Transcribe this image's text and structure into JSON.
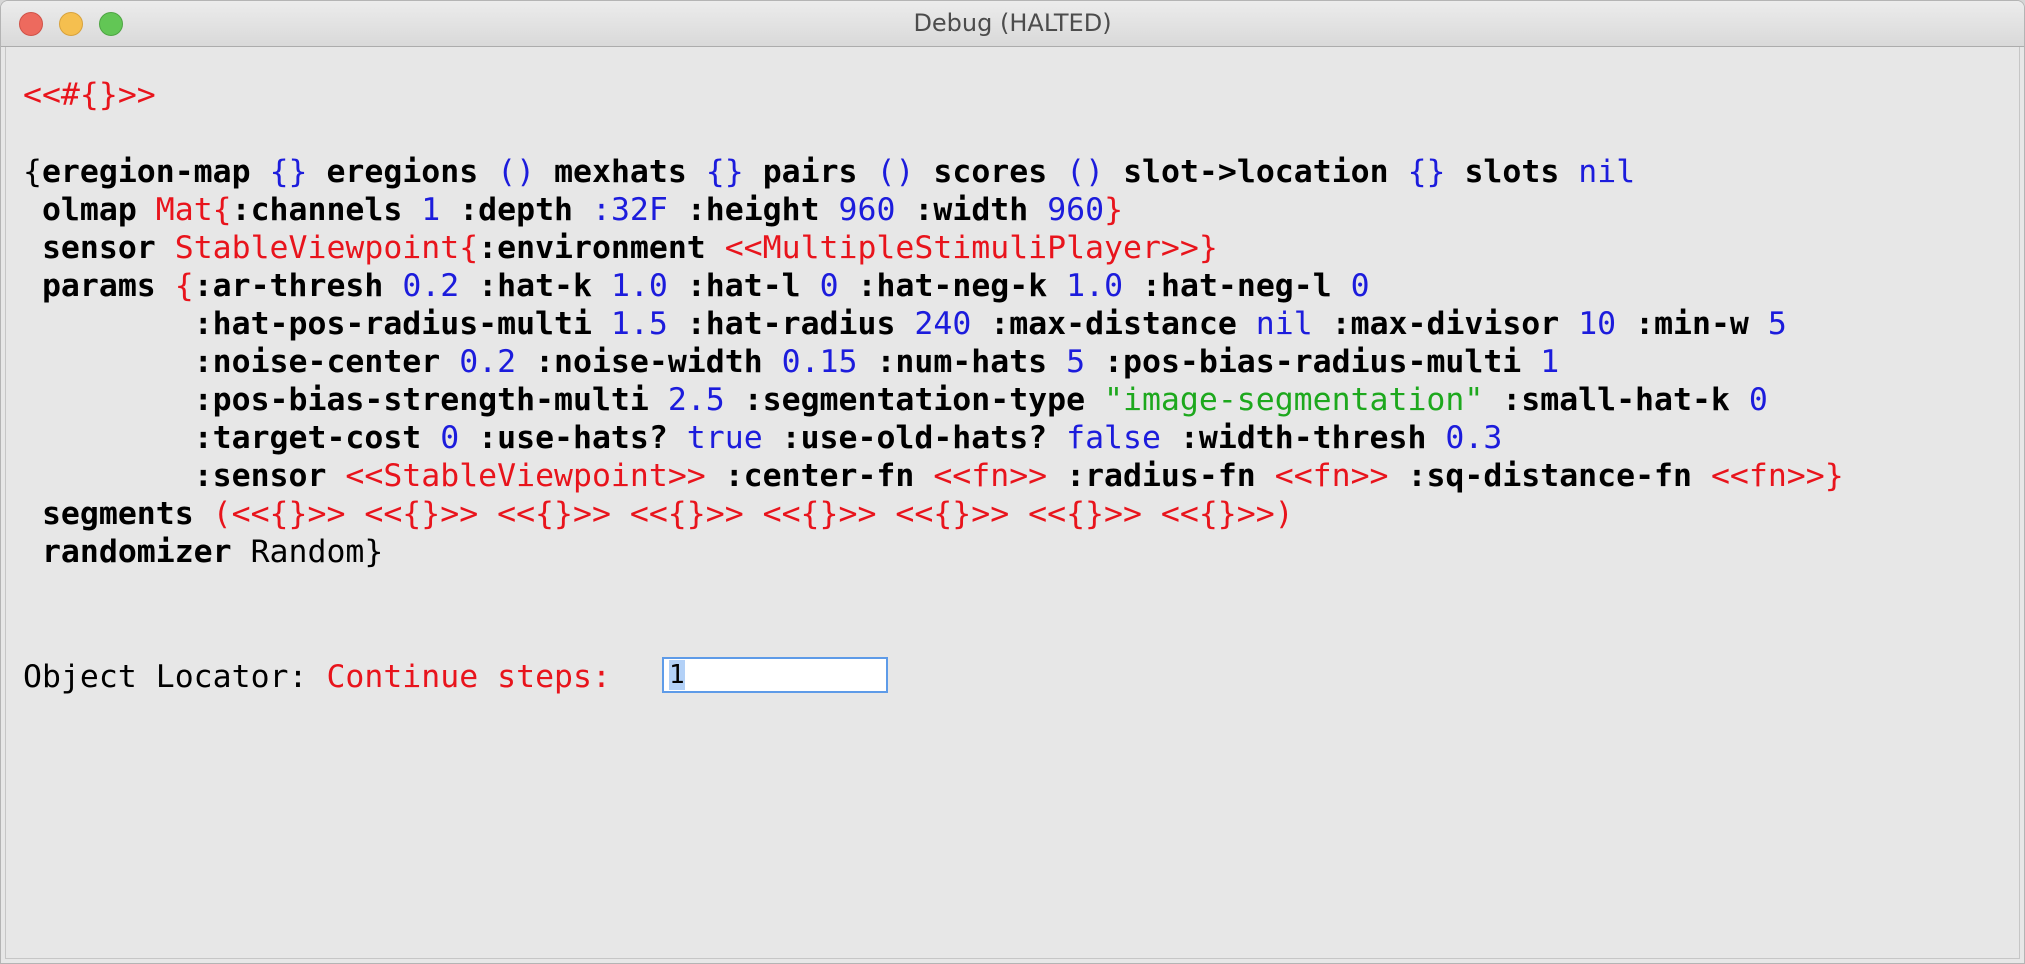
{
  "window": {
    "title": "Debug (HALTED)"
  },
  "repl": {
    "header": "<<#{}>>",
    "lines": [
      [
        {
          "t": "{",
          "c": "plain"
        },
        {
          "t": "eregion-map",
          "c": "k"
        },
        {
          "t": " ",
          "c": "plain"
        },
        {
          "t": "{}",
          "c": "b"
        },
        {
          "t": " ",
          "c": "plain"
        },
        {
          "t": "eregions",
          "c": "k"
        },
        {
          "t": " ",
          "c": "plain"
        },
        {
          "t": "()",
          "c": "b"
        },
        {
          "t": " ",
          "c": "plain"
        },
        {
          "t": "mexhats",
          "c": "k"
        },
        {
          "t": " ",
          "c": "plain"
        },
        {
          "t": "{}",
          "c": "b"
        },
        {
          "t": " ",
          "c": "plain"
        },
        {
          "t": "pairs",
          "c": "k"
        },
        {
          "t": " ",
          "c": "plain"
        },
        {
          "t": "()",
          "c": "b"
        },
        {
          "t": " ",
          "c": "plain"
        },
        {
          "t": "scores",
          "c": "k"
        },
        {
          "t": " ",
          "c": "plain"
        },
        {
          "t": "()",
          "c": "b"
        },
        {
          "t": " ",
          "c": "plain"
        },
        {
          "t": "slot->location",
          "c": "k"
        },
        {
          "t": " ",
          "c": "plain"
        },
        {
          "t": "{}",
          "c": "b"
        },
        {
          "t": " ",
          "c": "plain"
        },
        {
          "t": "slots",
          "c": "k"
        },
        {
          "t": " ",
          "c": "plain"
        },
        {
          "t": "nil",
          "c": "b"
        }
      ],
      [
        {
          "t": " ",
          "c": "plain"
        },
        {
          "t": "olmap",
          "c": "k"
        },
        {
          "t": " ",
          "c": "plain"
        },
        {
          "t": "Mat{",
          "c": "r"
        },
        {
          "t": ":channels",
          "c": "k"
        },
        {
          "t": " ",
          "c": "plain"
        },
        {
          "t": "1",
          "c": "b"
        },
        {
          "t": " ",
          "c": "plain"
        },
        {
          "t": ":depth",
          "c": "k"
        },
        {
          "t": " ",
          "c": "plain"
        },
        {
          "t": ":32F",
          "c": "b"
        },
        {
          "t": " ",
          "c": "plain"
        },
        {
          "t": ":height",
          "c": "k"
        },
        {
          "t": " ",
          "c": "plain"
        },
        {
          "t": "960",
          "c": "b"
        },
        {
          "t": " ",
          "c": "plain"
        },
        {
          "t": ":width",
          "c": "k"
        },
        {
          "t": " ",
          "c": "plain"
        },
        {
          "t": "960",
          "c": "b"
        },
        {
          "t": "}",
          "c": "r"
        }
      ],
      [
        {
          "t": " ",
          "c": "plain"
        },
        {
          "t": "sensor",
          "c": "k"
        },
        {
          "t": " ",
          "c": "plain"
        },
        {
          "t": "StableViewpoint{",
          "c": "r"
        },
        {
          "t": ":environment",
          "c": "k"
        },
        {
          "t": " ",
          "c": "plain"
        },
        {
          "t": "<<MultipleStimuliPlayer>>",
          "c": "r"
        },
        {
          "t": "}",
          "c": "r"
        }
      ],
      [
        {
          "t": " ",
          "c": "plain"
        },
        {
          "t": "params",
          "c": "k"
        },
        {
          "t": " ",
          "c": "plain"
        },
        {
          "t": "{",
          "c": "r"
        },
        {
          "t": ":ar-thresh",
          "c": "k"
        },
        {
          "t": " ",
          "c": "plain"
        },
        {
          "t": "0.2",
          "c": "b"
        },
        {
          "t": " ",
          "c": "plain"
        },
        {
          "t": ":hat-k",
          "c": "k"
        },
        {
          "t": " ",
          "c": "plain"
        },
        {
          "t": "1.0",
          "c": "b"
        },
        {
          "t": " ",
          "c": "plain"
        },
        {
          "t": ":hat-l",
          "c": "k"
        },
        {
          "t": " ",
          "c": "plain"
        },
        {
          "t": "0",
          "c": "b"
        },
        {
          "t": " ",
          "c": "plain"
        },
        {
          "t": ":hat-neg-k",
          "c": "k"
        },
        {
          "t": " ",
          "c": "plain"
        },
        {
          "t": "1.0",
          "c": "b"
        },
        {
          "t": " ",
          "c": "plain"
        },
        {
          "t": ":hat-neg-l",
          "c": "k"
        },
        {
          "t": " ",
          "c": "plain"
        },
        {
          "t": "0",
          "c": "b"
        }
      ],
      [
        {
          "t": "         ",
          "c": "plain"
        },
        {
          "t": ":hat-pos-radius-multi",
          "c": "k"
        },
        {
          "t": " ",
          "c": "plain"
        },
        {
          "t": "1.5",
          "c": "b"
        },
        {
          "t": " ",
          "c": "plain"
        },
        {
          "t": ":hat-radius",
          "c": "k"
        },
        {
          "t": " ",
          "c": "plain"
        },
        {
          "t": "240",
          "c": "b"
        },
        {
          "t": " ",
          "c": "plain"
        },
        {
          "t": ":max-distance",
          "c": "k"
        },
        {
          "t": " ",
          "c": "plain"
        },
        {
          "t": "nil",
          "c": "b"
        },
        {
          "t": " ",
          "c": "plain"
        },
        {
          "t": ":max-divisor",
          "c": "k"
        },
        {
          "t": " ",
          "c": "plain"
        },
        {
          "t": "10",
          "c": "b"
        },
        {
          "t": " ",
          "c": "plain"
        },
        {
          "t": ":min-w",
          "c": "k"
        },
        {
          "t": " ",
          "c": "plain"
        },
        {
          "t": "5",
          "c": "b"
        }
      ],
      [
        {
          "t": "         ",
          "c": "plain"
        },
        {
          "t": ":noise-center",
          "c": "k"
        },
        {
          "t": " ",
          "c": "plain"
        },
        {
          "t": "0.2",
          "c": "b"
        },
        {
          "t": " ",
          "c": "plain"
        },
        {
          "t": ":noise-width",
          "c": "k"
        },
        {
          "t": " ",
          "c": "plain"
        },
        {
          "t": "0.15",
          "c": "b"
        },
        {
          "t": " ",
          "c": "plain"
        },
        {
          "t": ":num-hats",
          "c": "k"
        },
        {
          "t": " ",
          "c": "plain"
        },
        {
          "t": "5",
          "c": "b"
        },
        {
          "t": " ",
          "c": "plain"
        },
        {
          "t": ":pos-bias-radius-multi",
          "c": "k"
        },
        {
          "t": " ",
          "c": "plain"
        },
        {
          "t": "1",
          "c": "b"
        }
      ],
      [
        {
          "t": "         ",
          "c": "plain"
        },
        {
          "t": ":pos-bias-strength-multi",
          "c": "k"
        },
        {
          "t": " ",
          "c": "plain"
        },
        {
          "t": "2.5",
          "c": "b"
        },
        {
          "t": " ",
          "c": "plain"
        },
        {
          "t": ":segmentation-type",
          "c": "k"
        },
        {
          "t": " ",
          "c": "plain"
        },
        {
          "t": "\"image-segmentation\"",
          "c": "g"
        },
        {
          "t": " ",
          "c": "plain"
        },
        {
          "t": ":small-hat-k",
          "c": "k"
        },
        {
          "t": " ",
          "c": "plain"
        },
        {
          "t": "0",
          "c": "b"
        }
      ],
      [
        {
          "t": "         ",
          "c": "plain"
        },
        {
          "t": ":target-cost",
          "c": "k"
        },
        {
          "t": " ",
          "c": "plain"
        },
        {
          "t": "0",
          "c": "b"
        },
        {
          "t": " ",
          "c": "plain"
        },
        {
          "t": ":use-hats?",
          "c": "k"
        },
        {
          "t": " ",
          "c": "plain"
        },
        {
          "t": "true",
          "c": "b"
        },
        {
          "t": " ",
          "c": "plain"
        },
        {
          "t": ":use-old-hats?",
          "c": "k"
        },
        {
          "t": " ",
          "c": "plain"
        },
        {
          "t": "false",
          "c": "b"
        },
        {
          "t": " ",
          "c": "plain"
        },
        {
          "t": ":width-thresh",
          "c": "k"
        },
        {
          "t": " ",
          "c": "plain"
        },
        {
          "t": "0.3",
          "c": "b"
        }
      ],
      [
        {
          "t": "         ",
          "c": "plain"
        },
        {
          "t": ":sensor",
          "c": "k"
        },
        {
          "t": " ",
          "c": "plain"
        },
        {
          "t": "<<StableViewpoint>>",
          "c": "r"
        },
        {
          "t": " ",
          "c": "plain"
        },
        {
          "t": ":center-fn",
          "c": "k"
        },
        {
          "t": " ",
          "c": "plain"
        },
        {
          "t": "<<fn>>",
          "c": "r"
        },
        {
          "t": " ",
          "c": "plain"
        },
        {
          "t": ":radius-fn",
          "c": "k"
        },
        {
          "t": " ",
          "c": "plain"
        },
        {
          "t": "<<fn>>",
          "c": "r"
        },
        {
          "t": " ",
          "c": "plain"
        },
        {
          "t": ":sq-distance-fn",
          "c": "k"
        },
        {
          "t": " ",
          "c": "plain"
        },
        {
          "t": "<<fn>>",
          "c": "r"
        },
        {
          "t": "}",
          "c": "r"
        }
      ],
      [
        {
          "t": " ",
          "c": "plain"
        },
        {
          "t": "segments",
          "c": "k"
        },
        {
          "t": " ",
          "c": "plain"
        },
        {
          "t": "(<<{}>> <<{}>> <<{}>> <<{}>> <<{}>> <<{}>> <<{}>> <<{}>>)",
          "c": "r"
        }
      ],
      [
        {
          "t": " ",
          "c": "plain"
        },
        {
          "t": "randomizer",
          "c": "k"
        },
        {
          "t": " ",
          "c": "plain"
        },
        {
          "t": "Random",
          "c": "plain"
        },
        {
          "t": "}",
          "c": "plain"
        }
      ]
    ]
  },
  "prompt": {
    "label": "Object Locator:",
    "continue_label": "Continue steps: ",
    "steps_value": "1"
  },
  "colors": {
    "keyword": "#000000",
    "red": "#e8141c",
    "blue": "#1c1cdc",
    "green": "#1da81d",
    "background": "#e7e7e7",
    "input_focus": "#5e9be8"
  }
}
